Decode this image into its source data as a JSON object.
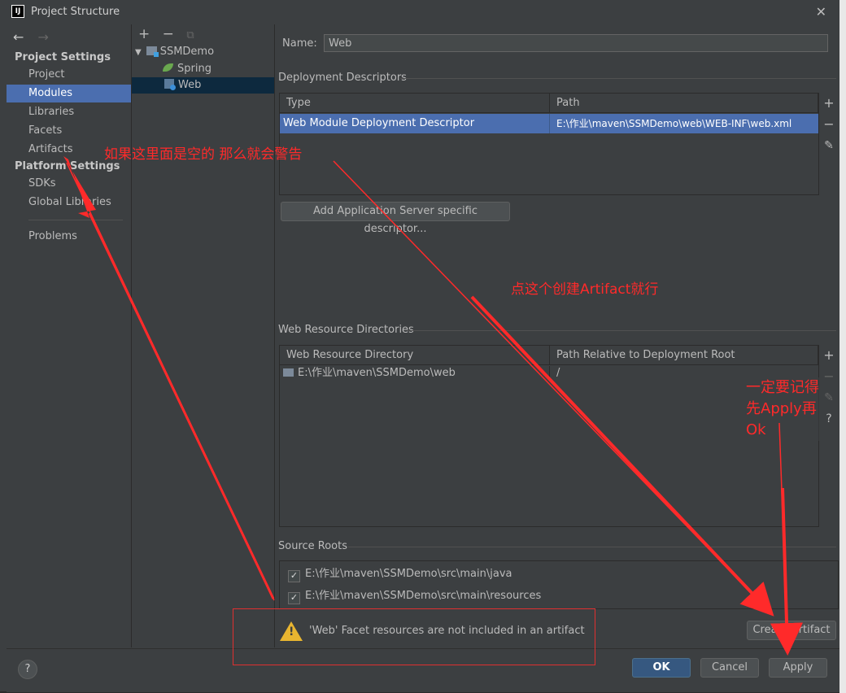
{
  "window": {
    "title": "Project Structure",
    "app_icon_text": "IJ"
  },
  "nav": {
    "project_settings_header": "Project Settings",
    "platform_settings_header": "Platform Settings",
    "items": [
      {
        "label": "Project"
      },
      {
        "label": "Modules",
        "selected": true
      },
      {
        "label": "Libraries"
      },
      {
        "label": "Facets"
      },
      {
        "label": "Artifacts"
      },
      {
        "label": "SDKs"
      },
      {
        "label": "Global Libraries"
      },
      {
        "label": "Problems"
      }
    ]
  },
  "tree": {
    "nodes": [
      {
        "label": "SSMDemo"
      },
      {
        "label": "Spring"
      },
      {
        "label": "Web",
        "selected": true
      }
    ]
  },
  "main": {
    "name_label": "Name:",
    "name_value": "Web",
    "deployment_descriptors": {
      "title": "Deployment Descriptors",
      "columns": [
        "Type",
        "Path"
      ],
      "rows": [
        {
          "type": "Web Module Deployment Descriptor",
          "path": "E:\\作业\\maven\\SSMDemo\\web\\WEB-INF\\web.xml"
        }
      ],
      "add_server_button": "Add Application Server specific descriptor..."
    },
    "web_resource_directories": {
      "title": "Web Resource Directories",
      "columns": [
        "Web Resource Directory",
        "Path Relative to Deployment Root"
      ],
      "rows": [
        {
          "directory": "E:\\作业\\maven\\SSMDemo\\web",
          "relative": "/"
        }
      ]
    },
    "source_roots": {
      "title": "Source Roots",
      "items": [
        {
          "path": "E:\\作业\\maven\\SSMDemo\\src\\main\\java",
          "checked": true
        },
        {
          "path": "E:\\作业\\maven\\SSMDemo\\src\\main\\resources",
          "checked": true
        }
      ]
    },
    "warning": "'Web' Facet resources are not included in an artifact",
    "create_artifact_button": "Create Artifact"
  },
  "footer": {
    "help": "?",
    "ok": "OK",
    "cancel": "Cancel",
    "apply": "Apply"
  },
  "annotations": {
    "note1": "如果这里面是空的 那么就会警告",
    "note2": "点这个创建Artifact就行",
    "note3_line1": "一定要记得",
    "note3_line2": "先Apply再",
    "note3_line3": "Ok"
  },
  "colors": {
    "selection": "#4b6eaf",
    "annotation": "#ff2a2a",
    "background": "#3c3f41",
    "warning": "#e8b530"
  }
}
